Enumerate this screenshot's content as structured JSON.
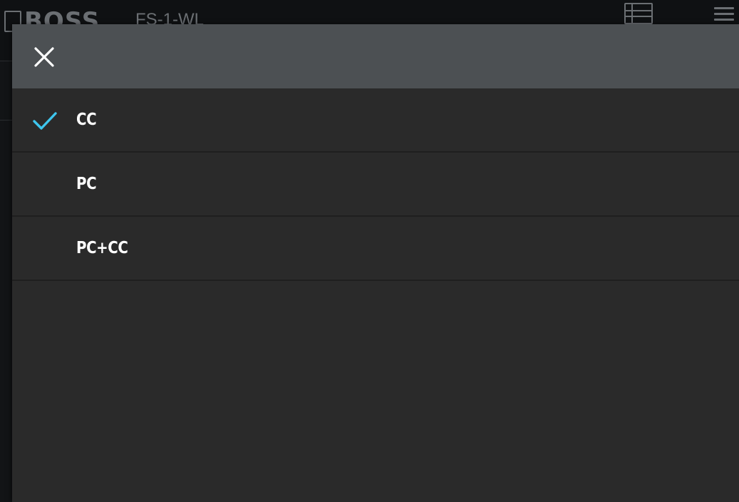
{
  "app": {
    "brand": "BOSS",
    "device_name": "FS-1-WL",
    "icons": {
      "list": "list-view-icon",
      "menu": "hamburger-menu-icon"
    }
  },
  "modal": {
    "close_icon": "close-icon",
    "check_icon": "checkmark-icon",
    "accent_color": "#3ec6ee",
    "selected_index": 0,
    "options": [
      {
        "label": "CC",
        "selected": true
      },
      {
        "label": "PC",
        "selected": false
      },
      {
        "label": "PC+CC",
        "selected": false
      }
    ]
  }
}
